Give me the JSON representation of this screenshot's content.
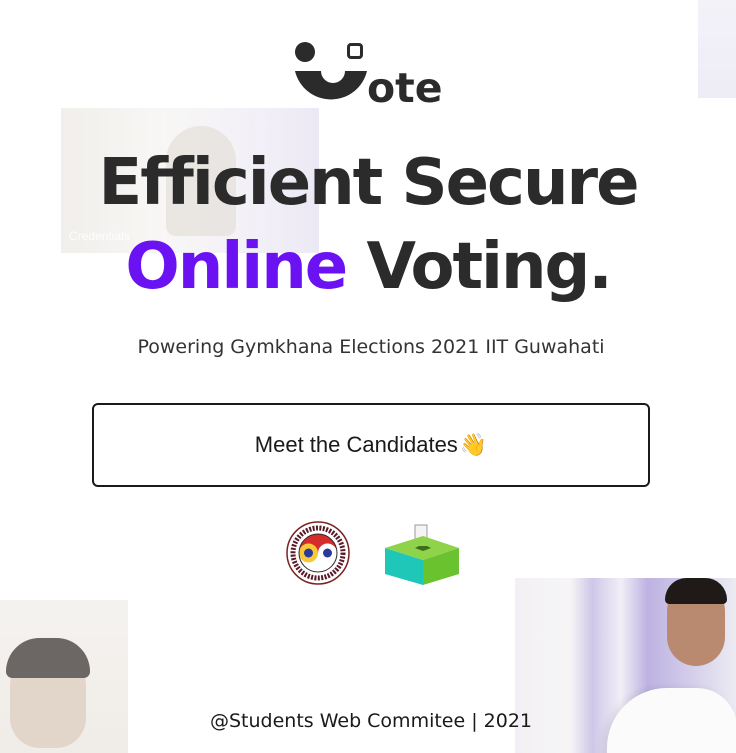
{
  "background": {
    "thumbnail_caption": "Credentials"
  },
  "logo": {
    "text": "ote",
    "icon": "smiley-v-icon"
  },
  "hero": {
    "line1": "Efficient Secure",
    "accent_word": "Online",
    "line2_rest": " Voting.",
    "accent_color": "#6b12f2",
    "subtitle": "Powering Gymkhana Elections 2021 IIT Guwahati"
  },
  "cta": {
    "label": "Meet the Candidates",
    "emoji": "👋"
  },
  "badges": {
    "emblem_icon": "iit-guwahati-emblem-icon",
    "ballot_icon": "ballot-box-icon"
  },
  "footer": {
    "text": "@Students Web Commitee | 2021"
  }
}
